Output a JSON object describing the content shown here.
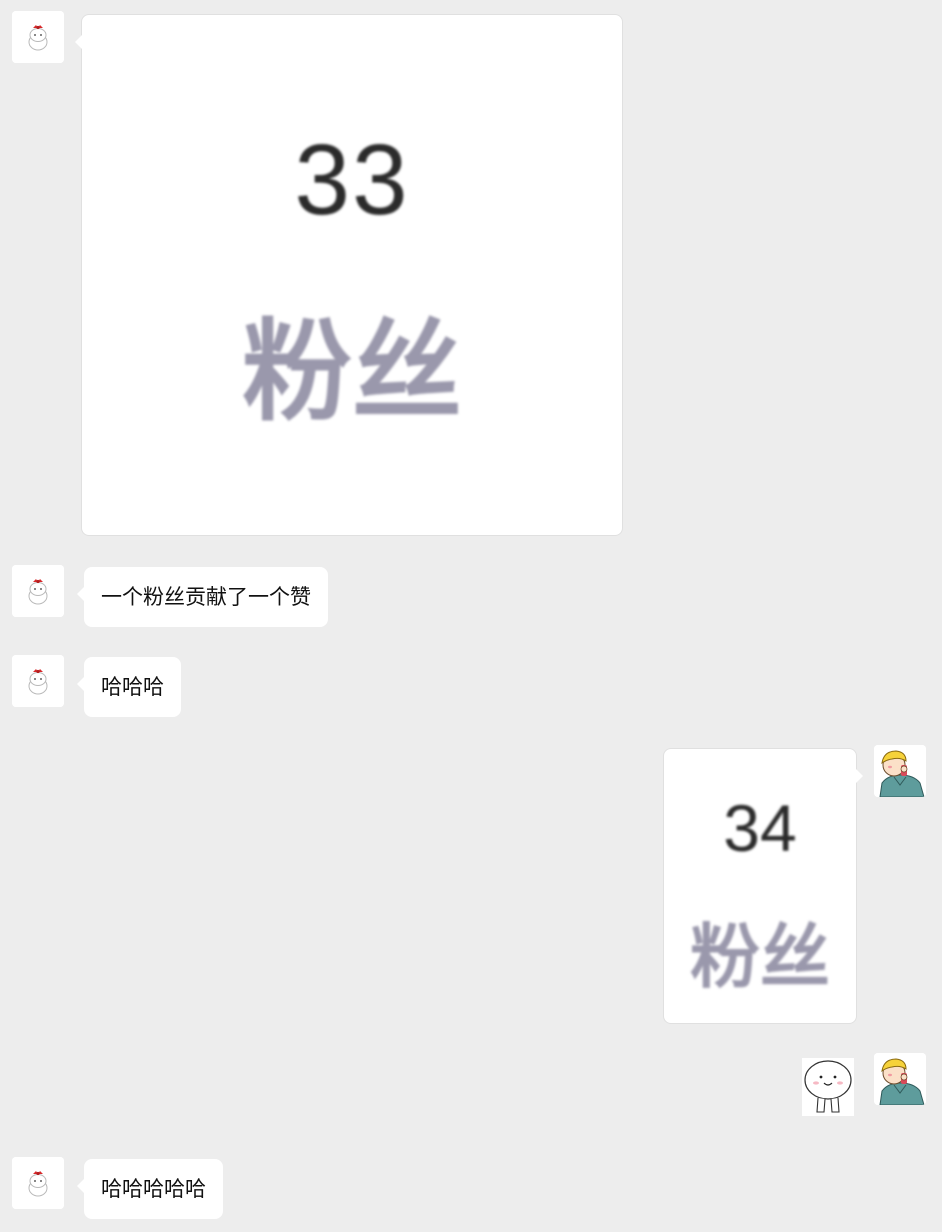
{
  "messages": [
    {
      "side": "left",
      "type": "image",
      "number": "33",
      "label": "粉丝"
    },
    {
      "side": "left",
      "type": "text",
      "text": "一个粉丝贡献了一个赞"
    },
    {
      "side": "left",
      "type": "text",
      "text": "哈哈哈"
    },
    {
      "side": "right",
      "type": "image",
      "number": "34",
      "label": "粉丝"
    },
    {
      "side": "right",
      "type": "sticker",
      "sticker": "smiling-dumpling-sticker"
    },
    {
      "side": "left",
      "type": "text",
      "text": "哈哈哈哈哈"
    }
  ],
  "avatars": {
    "friend": "cat-avatar-icon",
    "self": "cartoon-boy-avatar-icon"
  },
  "colors": {
    "background": "#ededed",
    "bubble": "#ffffff",
    "number_text": "#2b2b2b",
    "label_text": "#9a98ac"
  }
}
